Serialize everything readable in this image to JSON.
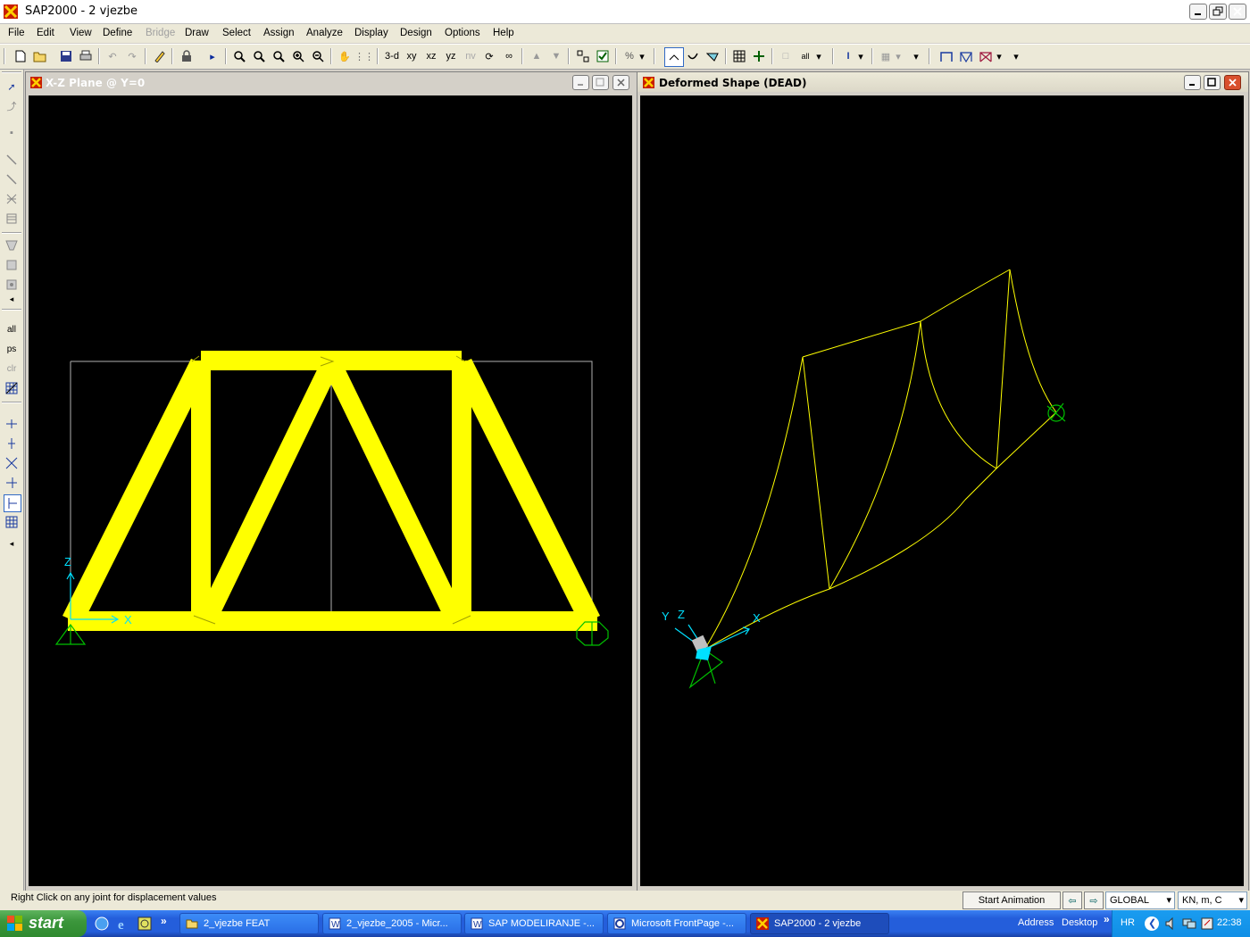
{
  "app": {
    "title": "SAP2000 - 2 vjezbe"
  },
  "menu": [
    {
      "label": "File"
    },
    {
      "label": "Edit"
    },
    {
      "label": "View"
    },
    {
      "label": "Define"
    },
    {
      "label": "Bridge",
      "disabled": true
    },
    {
      "label": "Draw"
    },
    {
      "label": "Select"
    },
    {
      "label": "Assign"
    },
    {
      "label": "Analyze"
    },
    {
      "label": "Display"
    },
    {
      "label": "Design"
    },
    {
      "label": "Options"
    },
    {
      "label": "Help"
    }
  ],
  "toolbar": {
    "view_3d": "3-d",
    "view_xy": "xy",
    "view_xz": "xz",
    "view_yz": "yz",
    "view_nv": "nv"
  },
  "left_tools": {
    "all": "all",
    "ps": "ps",
    "clr": "clr"
  },
  "left_window": {
    "title": "X-Z Plane @ Y=0",
    "axis_z": "Z",
    "axis_x": "X"
  },
  "right_window": {
    "title": "Deformed Shape (DEAD)",
    "axis_y": "Y",
    "axis_z": "Z",
    "axis_x": "X"
  },
  "status": {
    "message": "Right Click on any joint for displacement values",
    "animation_button": "Start Animation",
    "coord_system": "GLOBAL",
    "units": "KN, m, C"
  },
  "taskbar": {
    "start": "start",
    "tasks": [
      {
        "label": "2_vjezbe FEAT",
        "icon": "folder-icon"
      },
      {
        "label": "2_vjezbe_2005 - Micr...",
        "icon": "word-icon"
      },
      {
        "label": "SAP  MODELIRANJE -...",
        "icon": "word-icon"
      },
      {
        "label": "Microsoft FrontPage -...",
        "icon": "frontpage-icon"
      },
      {
        "label": "SAP2000 - 2 vjezbe",
        "icon": "sap-icon",
        "active": true
      }
    ],
    "address": "Address",
    "desktop": "Desktop",
    "language": "HR",
    "clock": "22:38"
  },
  "colors": {
    "truss": "#ffff00",
    "deformed": "#ffff00",
    "axis": "#00e0ff",
    "support": "#00c000",
    "canvas": "#000000"
  }
}
